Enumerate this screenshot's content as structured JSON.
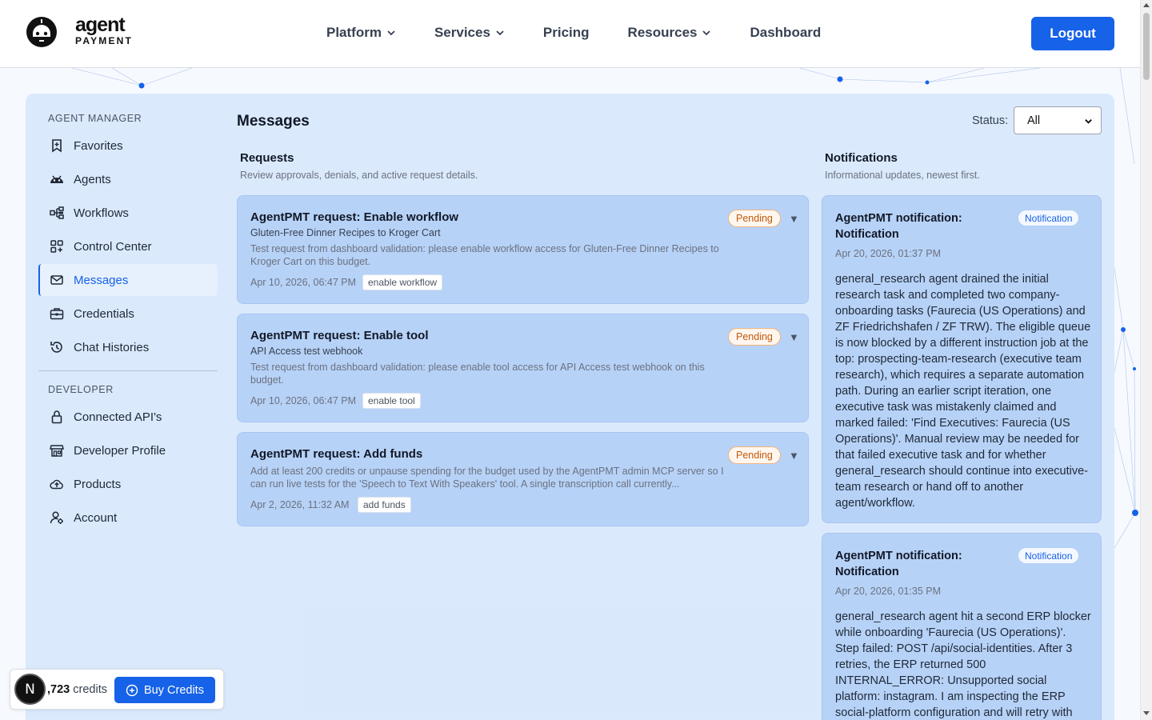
{
  "brand": {
    "word": "agent",
    "sub": "PAYMENT",
    "accent": "#1662e8"
  },
  "nav": {
    "items": [
      {
        "label": "Platform",
        "dropdown": true
      },
      {
        "label": "Services",
        "dropdown": true
      },
      {
        "label": "Pricing",
        "dropdown": false
      },
      {
        "label": "Resources",
        "dropdown": true
      },
      {
        "label": "Dashboard",
        "dropdown": false
      }
    ],
    "logout": "Logout"
  },
  "sidebar": {
    "section1": "AGENT MANAGER",
    "items1": [
      {
        "label": "Favorites",
        "icon": "bookmark-icon"
      },
      {
        "label": "Agents",
        "icon": "robot-icon"
      },
      {
        "label": "Workflows",
        "icon": "workflow-icon"
      },
      {
        "label": "Control Center",
        "icon": "grid-icon"
      },
      {
        "label": "Messages",
        "icon": "mail-icon",
        "active": true
      },
      {
        "label": "Credentials",
        "icon": "briefcase-icon"
      },
      {
        "label": "Chat Histories",
        "icon": "history-icon"
      }
    ],
    "section2": "DEVELOPER",
    "items2": [
      {
        "label": "Connected API's",
        "icon": "lock-icon"
      },
      {
        "label": "Developer Profile",
        "icon": "store-icon"
      },
      {
        "label": "Products",
        "icon": "cloud-upload-icon"
      },
      {
        "label": "Account",
        "icon": "user-gear-icon"
      }
    ]
  },
  "main": {
    "title": "Messages",
    "status_label": "Status:",
    "status_value": "All",
    "requests": {
      "title": "Requests",
      "subtitle": "Review approvals, denials, and active request details.",
      "items": [
        {
          "title": "AgentPMT request: Enable workflow",
          "subtitle": "Gluten-Free Dinner Recipes to Kroger Cart",
          "body": "Test request from dashboard validation: please enable workflow access for Gluten-Free Dinner Recipes to Kroger Cart on this budget.",
          "date": "Apr 10, 2026, 06:47 PM",
          "tag": "enable workflow",
          "status": "Pending"
        },
        {
          "title": "AgentPMT request: Enable tool",
          "subtitle": "API Access test webhook",
          "body": "Test request from dashboard validation: please enable tool access for API Access test webhook on this budget.",
          "date": "Apr 10, 2026, 06:47 PM",
          "tag": "enable tool",
          "status": "Pending"
        },
        {
          "title": "AgentPMT request: Add funds",
          "subtitle": "",
          "body": "Add at least 200 credits or unpause spending for the budget used by the AgentPMT admin MCP server so I can run live tests for the 'Speech to Text With Speakers' tool. A single transcription call currently...",
          "date": "Apr 2, 2026, 11:32 AM",
          "tag": "add funds",
          "status": "Pending"
        }
      ]
    },
    "notifications": {
      "title": "Notifications",
      "subtitle": "Informational updates, newest first.",
      "items": [
        {
          "title": "AgentPMT notification: Notification",
          "badge": "Notification",
          "date": "Apr 20, 2026, 01:37 PM",
          "body": "general_research agent drained the initial research task and completed two company-onboarding tasks (Faurecia (US Operations) and ZF Friedrichshafen / ZF TRW). The eligible queue is now blocked by a different instruction job at the top: prospecting-team-research (executive team research), which requires a separate automation path. During an earlier script iteration, one executive task was mistakenly claimed and marked failed: 'Find Executives: Faurecia (US Operations)'. Manual review may be needed for that failed executive task and for whether general_research should continue into executive-team research or hand off to another agent/workflow."
        },
        {
          "title": "AgentPMT notification: Notification",
          "badge": "Notification",
          "date": "Apr 20, 2026, 01:35 PM",
          "body": "general_research agent hit a second ERP blocker while onboarding 'Faurecia (US Operations)'. Step failed: POST /api/social-identities. After 3 retries, the ERP returned 500 INTERNAL_ERROR: Unsupported social platform: instagram. I am inspecting the ERP social-platform configuration and will retry with the platform values the"
        }
      ]
    }
  },
  "credits": {
    "badge": "N",
    "amount": ",723",
    "unit": " credits",
    "buy": "Buy Credits"
  }
}
